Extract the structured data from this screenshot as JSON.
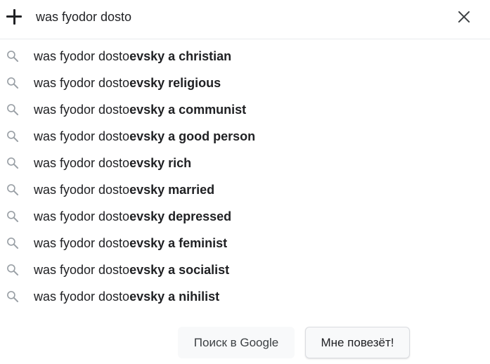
{
  "search": {
    "query": "was fyodor dosto",
    "plus_icon": "plus-icon",
    "clear_icon": "close-icon"
  },
  "suggestions": [
    {
      "prefix": "was fyodor dosto",
      "completion": "evsky a christian"
    },
    {
      "prefix": "was fyodor dosto",
      "completion": "evsky religious"
    },
    {
      "prefix": "was fyodor dosto",
      "completion": "evsky a communist"
    },
    {
      "prefix": "was fyodor dosto",
      "completion": "evsky a good person"
    },
    {
      "prefix": "was fyodor dosto",
      "completion": "evsky rich"
    },
    {
      "prefix": "was fyodor dosto",
      "completion": "evsky married"
    },
    {
      "prefix": "was fyodor dosto",
      "completion": "evsky depressed"
    },
    {
      "prefix": "was fyodor dosto",
      "completion": "evsky a feminist"
    },
    {
      "prefix": "was fyodor dosto",
      "completion": "evsky a socialist"
    },
    {
      "prefix": "was fyodor dosto",
      "completion": "evsky a nihilist"
    }
  ],
  "buttons": {
    "search_label": "Поиск в Google",
    "lucky_label": "Мне повезёт!"
  },
  "colors": {
    "text": "#202124",
    "icon_gray": "#9aa0a6",
    "button_bg": "#f8f9fa",
    "divider": "#e8eaed"
  }
}
